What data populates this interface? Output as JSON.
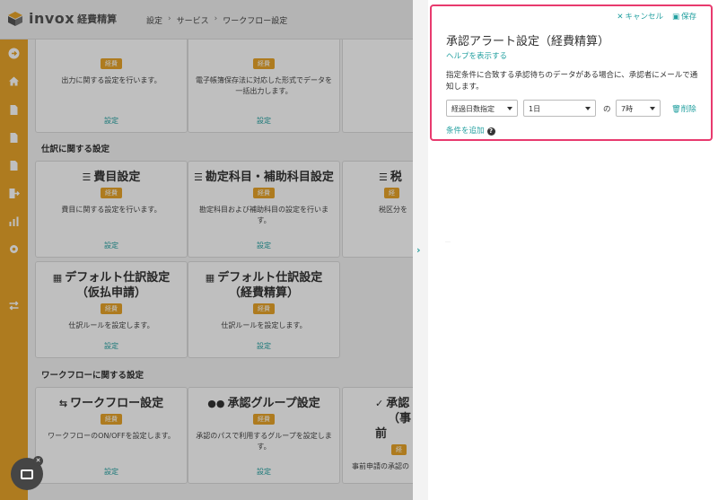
{
  "header": {
    "logo_text": "invox",
    "logo_sub": "経費精算",
    "breadcrumb": [
      "設定",
      "サービス",
      "ワークフロー設定"
    ]
  },
  "sidebar": {
    "icons": [
      "arrow-right-circle-icon",
      "home-icon",
      "document-icon",
      "document-icon",
      "document-icon",
      "export-icon",
      "chart-icon",
      "gear-icon",
      "transfer-icon"
    ]
  },
  "main": {
    "top_cards": [
      {
        "badge": "経費",
        "desc": "出力に関する設定を行います。",
        "link": "設定"
      },
      {
        "badge": "経費",
        "desc": "電子帳簿保存法に対応した形式でデータを一括出力します。",
        "link": "設定"
      }
    ],
    "section_journal": "仕訳に関する設定",
    "journal_cards": [
      {
        "icon": "list-icon",
        "title": "費目設定",
        "badge": "経費",
        "desc": "費目に関する設定を行います。",
        "link": "設定"
      },
      {
        "icon": "list-icon",
        "title": "勘定科目・補助科目設定",
        "badge": "経費",
        "desc": "勘定科目および補助科目の設定を行います。",
        "link": "設定"
      },
      {
        "icon": "list-icon",
        "title": "税",
        "badge": "経",
        "desc": "税区分を",
        "link": ""
      },
      {
        "icon": "table-icon",
        "title1": "デフォルト仕訳設定",
        "title2": "（仮払申請）",
        "badge": "経費",
        "desc": "仕訳ルールを設定します。",
        "link": "設定"
      },
      {
        "icon": "table-icon",
        "title1": "デフォルト仕訳設定",
        "title2": "（経費精算）",
        "badge": "経費",
        "desc": "仕訳ルールを設定します。",
        "link": "設定"
      }
    ],
    "section_workflow": "ワークフローに関する設定",
    "workflow_cards": [
      {
        "icon": "workflow-icon",
        "title": "ワークフロー設定",
        "badge": "経費",
        "desc": "ワークフローのON/OFFを設定します。",
        "link": "設定"
      },
      {
        "icon": "group-icon",
        "title": "承認グループ設定",
        "badge": "経費",
        "desc": "承認のパスで利用するグループを設定します。",
        "link": "設定"
      },
      {
        "icon": "approve-icon",
        "title1": "承認",
        "title2": "（事前",
        "badge": "経",
        "desc": "事前申請の承認の",
        "link": ""
      }
    ]
  },
  "panel": {
    "cancel_label": "キャンセル",
    "save_label": "保存",
    "title": "承認アラート設定（経費精算）",
    "help_link": "ヘルプを表示する",
    "description": "指定条件に合致する承認待ちのデータがある場合に、承認者にメールで通知します。",
    "condition_type": "経過日数指定",
    "days": "1日",
    "no_label": "の",
    "time": "7時",
    "delete_label": "削除",
    "add_condition": "条件を追加"
  },
  "colors": {
    "accent": "#e8a52a",
    "link": "#23a0a0",
    "highlight": "#e83a6e"
  }
}
